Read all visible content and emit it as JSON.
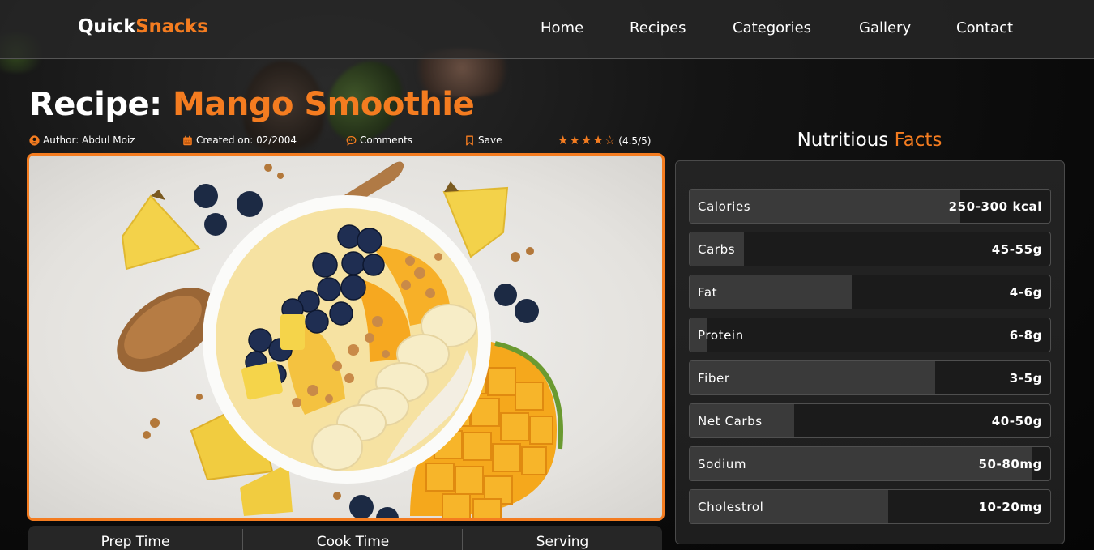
{
  "brand": {
    "part1": "Quick",
    "part2": "Snacks"
  },
  "nav": {
    "items": [
      {
        "label": "Home"
      },
      {
        "label": "Recipes"
      },
      {
        "label": "Categories"
      },
      {
        "label": "Gallery"
      },
      {
        "label": "Contact"
      }
    ]
  },
  "recipe": {
    "title_prefix": "Recipe:",
    "title_name": "Mango Smoothie",
    "author": "Author: Abdul Moiz",
    "created": "Created on: 02/2004",
    "comments": "Comments",
    "save": "Save",
    "rating_text": "(4.5/5)",
    "rating_value": 4.5,
    "rating_max": 5,
    "image_icon": "mango-smoothie-bowl-photo"
  },
  "times": {
    "prep": "Prep Time",
    "cook": "Cook Time",
    "serving": "Serving"
  },
  "nutrition": {
    "heading_part1": "Nutritious",
    "heading_part2": "Facts",
    "rows": [
      {
        "label": "Calories",
        "value": "250-300 kcal",
        "fill": 0.75
      },
      {
        "label": "Carbs",
        "value": "45-55g",
        "fill": 0.15
      },
      {
        "label": "Fat",
        "value": "4-6g",
        "fill": 0.45
      },
      {
        "label": "Protein",
        "value": "6-8g",
        "fill": 0.05
      },
      {
        "label": "Fiber",
        "value": "3-5g",
        "fill": 0.68
      },
      {
        "label": "Net Carbs",
        "value": "40-50g",
        "fill": 0.29
      },
      {
        "label": "Sodium",
        "value": "50-80mg",
        "fill": 0.95
      },
      {
        "label": "Cholestrol",
        "value": "10-20mg",
        "fill": 0.55
      }
    ]
  },
  "colors": {
    "accent": "#f47c20",
    "panel": "#1e1e1e",
    "bar_fill": "#3a3a3a"
  }
}
